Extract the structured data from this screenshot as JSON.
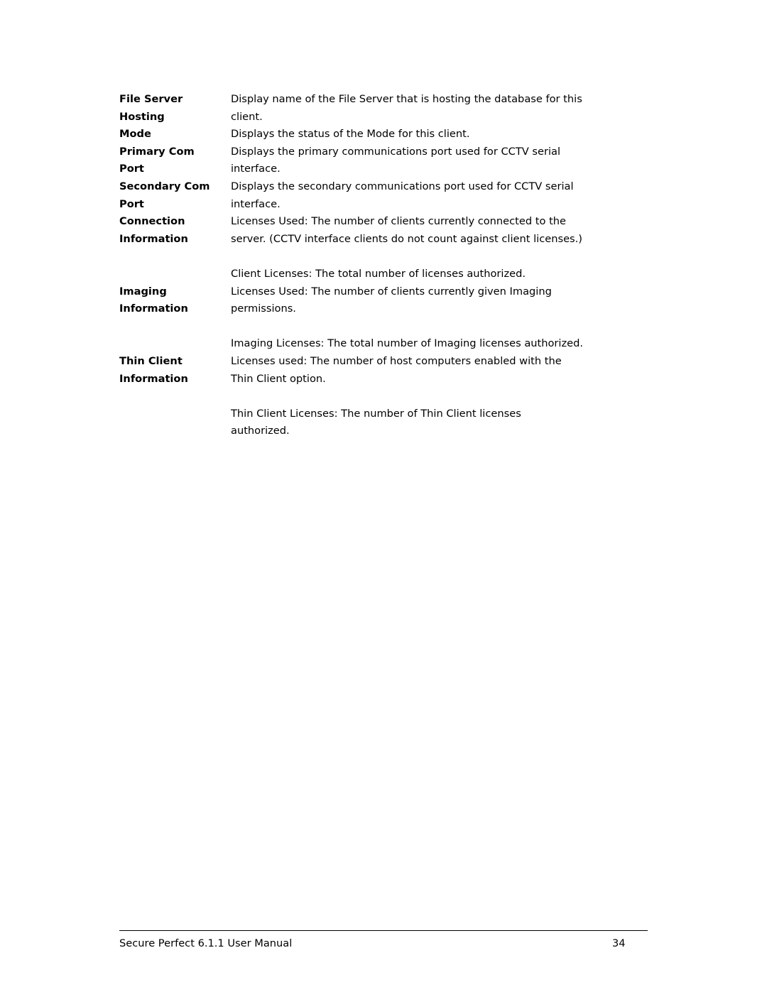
{
  "document": {
    "rows": [
      {
        "term_lines": [
          "File Server",
          "Hosting"
        ],
        "desc_lines": [
          "Display name of the File Server that is hosting the database for this",
          "client."
        ]
      },
      {
        "term_lines": [
          "Mode"
        ],
        "desc_lines": [
          "Displays the status of the Mode for this client."
        ]
      },
      {
        "term_lines": [
          "Primary Com",
          "Port"
        ],
        "desc_lines": [
          "Displays the primary communications port used for CCTV serial",
          "interface."
        ]
      },
      {
        "term_lines": [
          "Secondary Com",
          "Port"
        ],
        "desc_lines": [
          "Displays the secondary communications port used for CCTV serial",
          "interface."
        ]
      },
      {
        "term_lines": [
          "Connection",
          "Information"
        ],
        "desc_lines": [
          "Licenses Used: The number of clients currently connected to the",
          "server. (CCTV interface clients do not count against client licenses.)",
          "",
          "Client Licenses: The total number of licenses authorized."
        ]
      },
      {
        "term_lines": [
          "Imaging",
          "Information"
        ],
        "desc_lines": [
          "Licenses Used: The number of clients currently given Imaging",
          "permissions.",
          "",
          "Imaging Licenses: The total number of Imaging licenses authorized."
        ]
      },
      {
        "term_lines": [
          "Thin Client",
          "Information"
        ],
        "desc_lines": [
          "Licenses used: The number of host computers enabled with the",
          "Thin Client option.",
          "",
          "Thin Client Licenses: The number of Thin Client licenses",
          "authorized."
        ]
      }
    ]
  },
  "footer": {
    "manual_title": "Secure Perfect 6.1.1 User Manual",
    "page_number": "34"
  }
}
